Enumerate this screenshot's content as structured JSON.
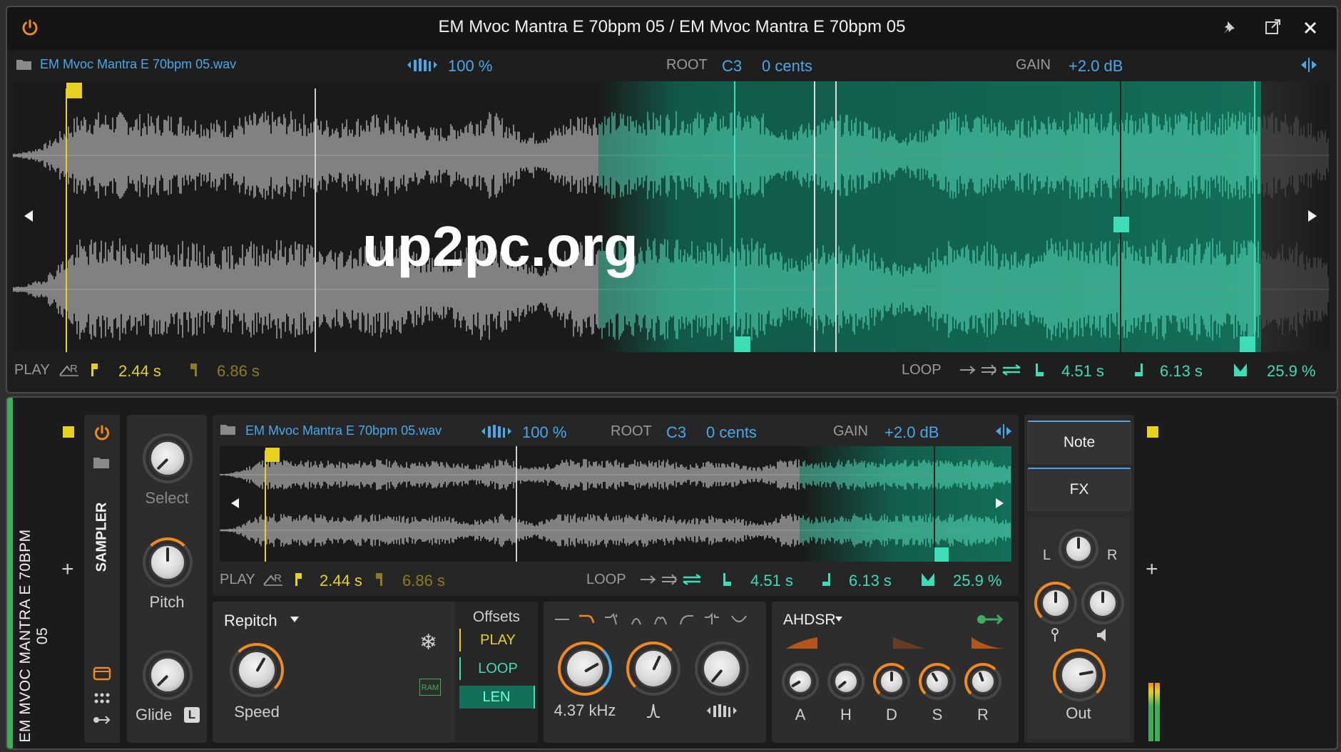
{
  "window": {
    "title": "EM Mvoc Mantra E 70bpm 05 / EM Mvoc Mantra E 70bpm 05",
    "icons": [
      "power-icon",
      "pin-icon",
      "popout-icon",
      "close-icon"
    ]
  },
  "editor": {
    "filename": "EM Mvoc Mantra E 70bpm 05.wav",
    "speed": "100 %",
    "root_label": "ROOT",
    "root_note": "C3",
    "cents": "0 cents",
    "gain_label": "GAIN",
    "gain": "+2.0 dB",
    "play_label": "PLAY",
    "play_start": "2.44 s",
    "play_end": "6.86 s",
    "loop_label": "LOOP",
    "loop_start": "4.51 s",
    "loop_end": "6.13 s",
    "crossfade": "25.9 %",
    "watermark": "up2pc.org"
  },
  "device": {
    "track_name": "EM MVOC MANTRA E 70BPM 05",
    "device_name": "SAMPLER",
    "knobs": {
      "select": "Select",
      "pitch": "Pitch",
      "glide": "Glide",
      "glide_badge": "L",
      "speed": "Speed",
      "filter_freq": "4.37 kHz"
    },
    "mode": "Repitch",
    "offsets": {
      "title": "Offsets",
      "play": "PLAY",
      "loop": "LOOP",
      "len": "LEN"
    },
    "ram_label": "RAM",
    "envelope": {
      "type": "AHDSR",
      "stages": [
        "A",
        "H",
        "D",
        "S",
        "R"
      ]
    },
    "side_tabs": {
      "note": "Note",
      "fx": "FX"
    },
    "pan": {
      "left": "L",
      "right": "R"
    },
    "out_label": "Out",
    "plus": "+"
  },
  "colors": {
    "accent_blue": "#4aa8e8",
    "loop_teal": "#3fdcb8",
    "play_yellow": "#e8d21e",
    "orange": "#f08a1c",
    "device_green": "#3fae5a"
  }
}
